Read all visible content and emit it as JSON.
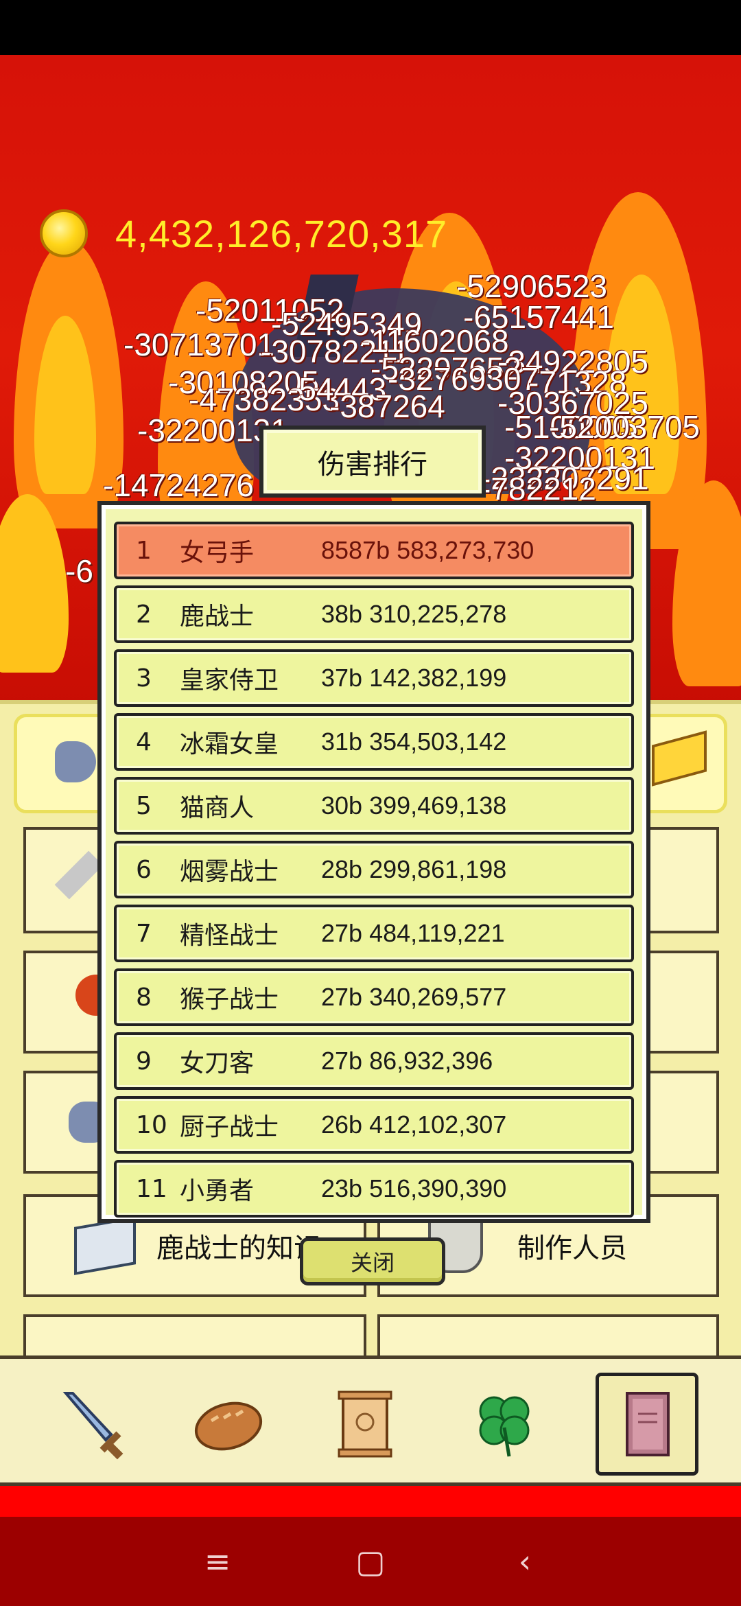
{
  "coins": {
    "amount": "4,432,126,720,317"
  },
  "damage_numbers": [
    "-52906523",
    "-52011052",
    "-52495349",
    "-65157441",
    "-30713701",
    "-30782211",
    "-11602068",
    "-34922805",
    "-30108205",
    "-52297652",
    "-32769307",
    "-71328",
    "-47382353",
    "-54443",
    "-387264",
    "-30367025",
    "-5100005",
    "-52003705",
    "-32200131",
    "-32200131",
    "-232207291",
    "-14724276",
    "-782212",
    "-6"
  ],
  "ranking": {
    "title": "伤害排行",
    "rows": [
      {
        "rank": "1",
        "name": "女弓手",
        "damage": "8587b 583,273,730"
      },
      {
        "rank": "2",
        "name": "鹿战士",
        "damage": "38b 310,225,278"
      },
      {
        "rank": "3",
        "name": "皇家侍卫",
        "damage": "37b 142,382,199"
      },
      {
        "rank": "4",
        "name": "冰霜女皇",
        "damage": "31b 354,503,142"
      },
      {
        "rank": "5",
        "name": "猫商人",
        "damage": "30b 399,469,138"
      },
      {
        "rank": "6",
        "name": "烟雾战士",
        "damage": "28b 299,861,198"
      },
      {
        "rank": "7",
        "name": "精怪战士",
        "damage": "27b 484,119,221"
      },
      {
        "rank": "8",
        "name": "猴子战士",
        "damage": "27b 340,269,577"
      },
      {
        "rank": "9",
        "name": "女刀客",
        "damage": "27b 86,932,396"
      },
      {
        "rank": "10",
        "name": "厨子战士",
        "damage": "26b 412,102,307"
      },
      {
        "rank": "11",
        "name": "小勇者",
        "damage": "23b 516,390,390"
      }
    ],
    "close_label": "关闭"
  },
  "menu": {
    "knowledge_label": "鹿战士的知识",
    "credits_label": "制作人员"
  },
  "bottom_nav": {
    "items": [
      "sword-icon",
      "bread-icon",
      "scroll-icon",
      "clover-icon",
      "book-icon"
    ],
    "active": "book-icon"
  },
  "system_nav": {
    "menu_glyph": "≡",
    "home_glyph": "▢",
    "back_glyph": "‹"
  },
  "colors": {
    "background_red": "#d61208",
    "coin_text": "#ffee2a",
    "first_row": "#f58b62",
    "row": "#eef59e",
    "panel": "#f2f6b2"
  }
}
